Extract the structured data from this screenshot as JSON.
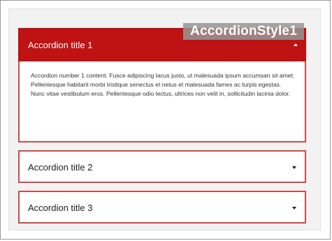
{
  "accordion": {
    "items": [
      {
        "title": "Accordion title 1",
        "content": "Accordion number 1 content. Fusce adipiscing lacus justo, ut malesuada ipsum accumsan sit amet. Pellentesque habitant morbi tristique senectus et netus et malesuada fames ac turpis egestas. Nunc vitae vestibulum eros. Pellentesque odio lectus, ultrices non velit in, sollicitudin lacinia dolor.",
        "expanded": true,
        "icon": "chevron-up-icon"
      },
      {
        "title": "Accordion title 2",
        "expanded": false,
        "icon": "chevron-down-icon"
      },
      {
        "title": "Accordion title 3",
        "expanded": false,
        "icon": "chevron-down-icon"
      }
    ]
  },
  "watermark": {
    "text": "AccordionStyle1"
  },
  "colors": {
    "header_active": "#bf1212",
    "border": "#d04a4a",
    "panel_bg": "#f2f2f2",
    "watermark_bg": "#969696"
  }
}
